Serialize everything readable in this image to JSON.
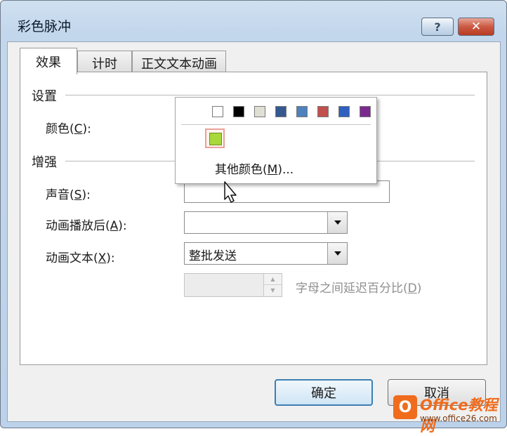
{
  "window": {
    "title": "彩色脉冲",
    "help_glyph": "?",
    "close_glyph": "✕"
  },
  "tabs": [
    {
      "label": "效果",
      "active": true
    },
    {
      "label": "计时",
      "active": false
    },
    {
      "label": "正文文本动画",
      "active": false
    }
  ],
  "settings": {
    "section_title": "设置",
    "color_label_prefix": "颜色(",
    "color_label_key": "C",
    "color_label_suffix": "):",
    "selected_color": "#a8d83a"
  },
  "color_dropdown": {
    "swatches": [
      "#ffffff",
      "#000000",
      "#e0dfd4",
      "#35588f",
      "#4f81bd",
      "#c0504d",
      "#2f5fbf",
      "#7a2a8f"
    ],
    "recent_color": "#a8d83a",
    "more_colors_prefix": "其他颜色(",
    "more_colors_key": "M",
    "more_colors_suffix": ")..."
  },
  "enhance": {
    "section_title": "增强",
    "sound_label_prefix": "声音(",
    "sound_label_key": "S",
    "sound_label_suffix": "):",
    "after_label_prefix": "动画播放后(",
    "after_label_key": "A",
    "after_label_suffix": "):",
    "text_label_prefix": "动画文本(",
    "text_label_key": "X",
    "text_label_suffix": "):",
    "text_value": "整批发送",
    "delay_label_prefix": "字母之间延迟百分比(",
    "delay_label_key": "D",
    "delay_label_suffix": ")",
    "delay_value": ""
  },
  "buttons": {
    "ok": "确定",
    "cancel": "取消"
  },
  "watermark": {
    "logo": "O",
    "name": "Office教程网",
    "url": "www.office26.com"
  },
  "colors": {
    "accent": "#3c7fb1",
    "close_red": "#c7472f"
  }
}
